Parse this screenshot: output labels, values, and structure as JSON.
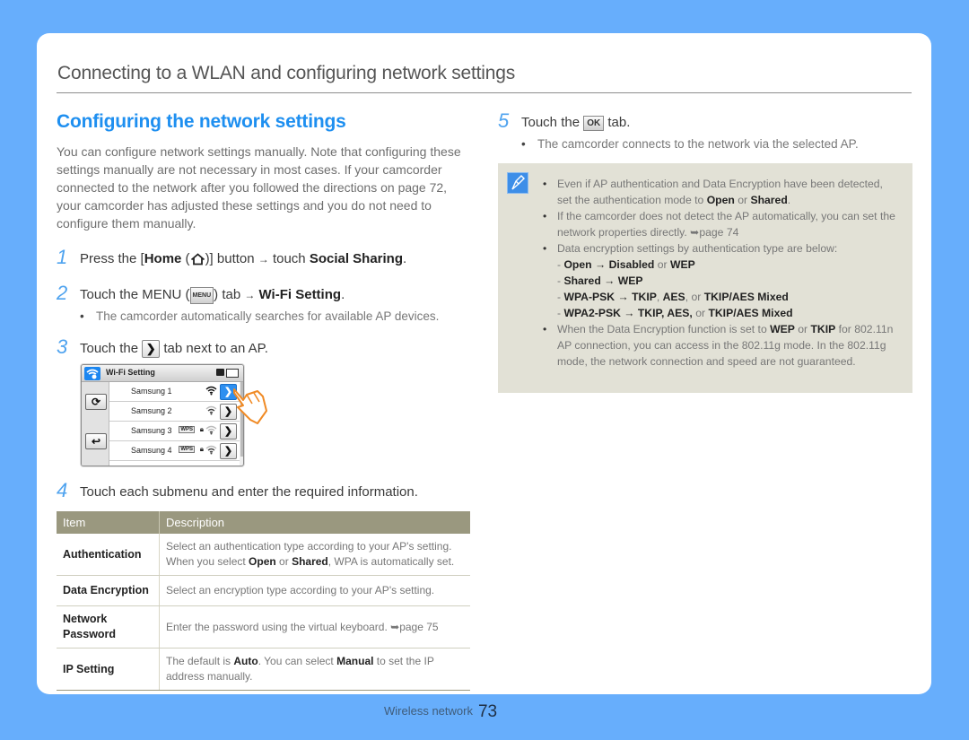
{
  "chapter_title": "Connecting to a WLAN and configuring network settings",
  "section_title": "Configuring the network settings",
  "intro": "You can configure network settings manually. Note that configuring these settings manually are not necessary in most cases. If your camcorder connected to the network after you followed the directions on page 72, your camcorder has adjusted these settings and you do not need to configure them manually.",
  "steps": {
    "s1": {
      "num": "1",
      "a": "Press the [",
      "home": "Home",
      "b": " (",
      "c": ")] button",
      "arrow": "→",
      "d": " touch ",
      "target": "Social Sharing",
      "e": "."
    },
    "s2": {
      "num": "2",
      "a": "Touch the MENU (",
      "key": "MENU",
      "b": ") tab ",
      "arrow": "→",
      "target": "Wi-Fi Setting",
      "e": ".",
      "sub": "The camcorder automatically searches for available AP devices."
    },
    "s3": {
      "num": "3",
      "a": "Touch the ",
      "key": "❯",
      "b": " tab next to an AP."
    },
    "s4": {
      "num": "4",
      "text": "Touch each submenu and enter the required information."
    },
    "s5": {
      "num": "5",
      "a": "Touch the ",
      "key": "OK",
      "b": " tab.",
      "sub": "The camcorder connects to the network via the selected AP."
    }
  },
  "device": {
    "title": "Wi-Fi Setting",
    "icons": [
      "wifi-settings-icon",
      "sd-card-icon",
      "battery-icon",
      "refresh-icon",
      "back-icon",
      "hand-pointer-icon"
    ],
    "networks": [
      {
        "ssid": "Samsung 1",
        "wps": "",
        "lock": false,
        "signal": "strong",
        "selected": true
      },
      {
        "ssid": "Samsung 2",
        "wps": "",
        "lock": false,
        "signal": "medium",
        "selected": false
      },
      {
        "ssid": "Samsung 3",
        "wps": "WPS",
        "lock": true,
        "signal": "weak",
        "selected": false
      },
      {
        "ssid": "Samsung 4",
        "wps": "WPS",
        "lock": true,
        "signal": "medium",
        "selected": false
      }
    ]
  },
  "table": {
    "headers": [
      "Item",
      "Description"
    ],
    "rows": [
      {
        "item": "Authentication",
        "d1": "Select an authentication type according to your AP's setting. When you select ",
        "b1": "Open",
        "d2": " or ",
        "b2": "Shared",
        "d3": ", WPA is automatically set."
      },
      {
        "item": "Data Encryption",
        "d1": "Select an encryption type according to your AP's setting."
      },
      {
        "item": "Network Password",
        "d1": "Enter the password using the virtual keyboard. ",
        "ref": "➥page 75"
      },
      {
        "item": "IP Setting",
        "d1": "The default is ",
        "b1": "Auto",
        "d2": ". You can select ",
        "b2": "Manual",
        "d3": " to set the IP address manually."
      }
    ]
  },
  "note": {
    "n1": {
      "a": "Even if AP authentication and Data Encryption have been detected, set the authentication mode to ",
      "b1": "Open",
      "c": " or ",
      "b2": "Shared",
      "d": "."
    },
    "n2": {
      "a": "If the camcorder does not detect the AP automatically, you can set the network properties directly. ",
      "ref": "➥page 74"
    },
    "n3": {
      "a": "Data encryption settings by authentication type are below:"
    },
    "dashes": [
      {
        "auth": "Open",
        "arrow": "→",
        "v1": "Disabled",
        "sep": " or ",
        "v2": "WEP"
      },
      {
        "auth": "Shared",
        "arrow": "→",
        "v1": "WEP"
      },
      {
        "auth": "WPA-PSK",
        "arrow": "→",
        "v1": "TKIP",
        "sep1": ", ",
        "v2": "AES",
        "sep2": ", or ",
        "v3": "TKIP/AES Mixed"
      },
      {
        "auth": "WPA2-PSK",
        "arrow": "→",
        "v1": "TKIP, AES,",
        "sep": " or ",
        "v2": "TKIP/AES Mixed"
      }
    ],
    "n4": {
      "a": "When the Data Encryption function is set to ",
      "b1": "WEP",
      "c": " or ",
      "b2": "TKIP",
      "d": " for 802.11n AP connection, you can access in the 802.11g mode. In the 802.11g mode, the network connection and speed are not guaranteed."
    }
  },
  "footer": {
    "section": "Wireless network",
    "page": "73"
  },
  "colors": {
    "background": "#67aefc",
    "accent": "#1e8ff0",
    "table_header": "#9a987f",
    "note_bg": "#e2e1d6"
  }
}
